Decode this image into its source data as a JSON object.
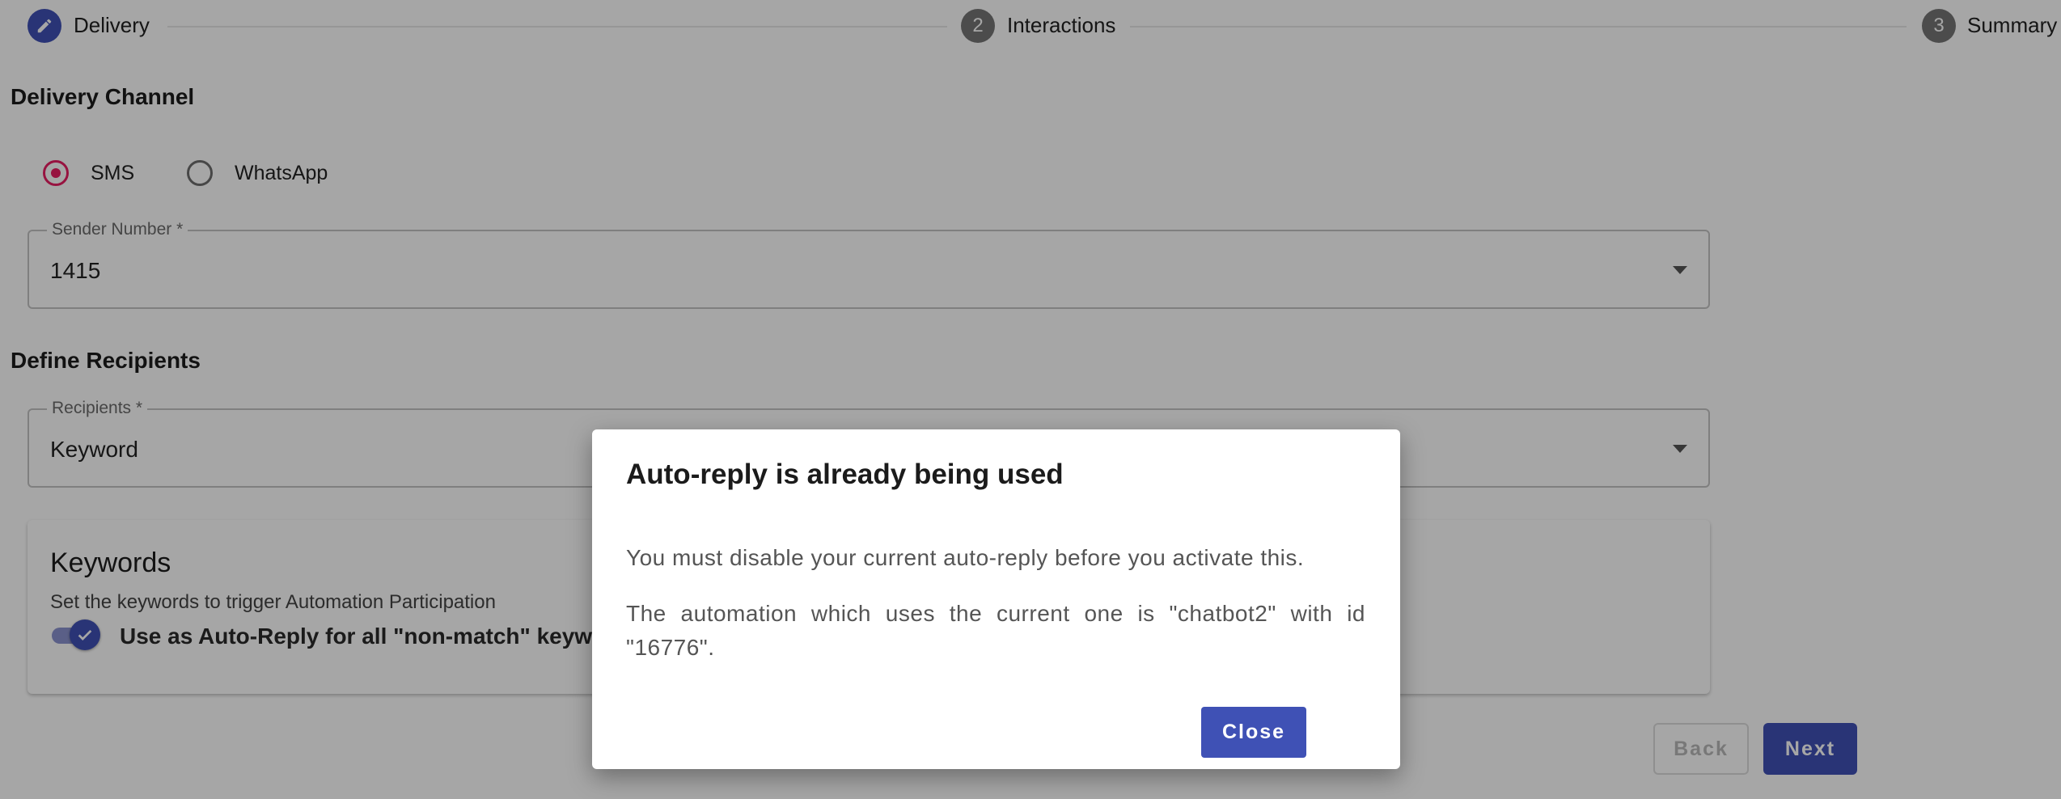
{
  "stepper": {
    "steps": [
      {
        "number": "",
        "label": "Delivery",
        "icon": "pencil-icon"
      },
      {
        "number": "2",
        "label": "Interactions"
      },
      {
        "number": "3",
        "label": "Summary"
      }
    ]
  },
  "delivery_channel": {
    "title": "Delivery Channel",
    "options": [
      {
        "label": "SMS",
        "selected": true
      },
      {
        "label": "WhatsApp",
        "selected": false
      }
    ]
  },
  "sender_number": {
    "label": "Sender Number *",
    "value": "1415"
  },
  "define_recipients": {
    "title": "Define Recipients"
  },
  "recipients": {
    "label": "Recipients *",
    "value": "Keyword"
  },
  "keywords_card": {
    "title": "Keywords",
    "subtitle": "Set the keywords to trigger Automation Participation",
    "toggle_label": "Use as Auto-Reply for all \"non-match\" keywords",
    "toggle_on": true
  },
  "footer": {
    "back_label": "Back",
    "next_label": "Next"
  },
  "dialog": {
    "title": "Auto-reply is already being used",
    "message1": "You must disable your current auto-reply before you activate this.",
    "message2": "The automation which uses the current one is \"chatbot2\" with id \"16776\".",
    "close_label": "Close"
  },
  "colors": {
    "primary": "#3f51b5",
    "radio_selected": "#e91e63",
    "step_inactive": "#757575"
  }
}
